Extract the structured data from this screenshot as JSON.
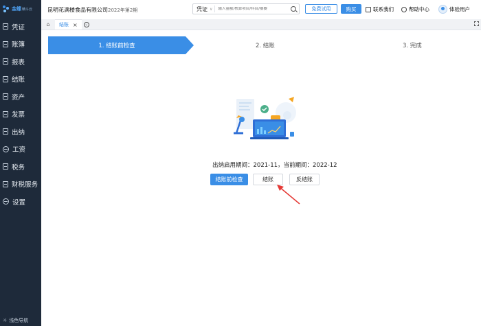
{
  "app": {
    "logo_text": "金蝶",
    "logo_sub": "精斗云"
  },
  "sidebar": {
    "items": [
      {
        "label": "凭证",
        "icon": "voucher-icon"
      },
      {
        "label": "账簿",
        "icon": "ledger-icon"
      },
      {
        "label": "报表",
        "icon": "report-icon"
      },
      {
        "label": "结账",
        "icon": "closing-icon"
      },
      {
        "label": "资产",
        "icon": "asset-icon"
      },
      {
        "label": "发票",
        "icon": "invoice-icon"
      },
      {
        "label": "出纳",
        "icon": "cashier-icon"
      },
      {
        "label": "工资",
        "icon": "salary-icon"
      },
      {
        "label": "税务",
        "icon": "tax-icon"
      },
      {
        "label": "财税服务",
        "icon": "finance-service-icon"
      },
      {
        "label": "设置",
        "icon": "settings-icon"
      }
    ],
    "footer_label": "浅色导航"
  },
  "header": {
    "company": "昆明花满楼食品有限公司",
    "period": "2022年第2期",
    "search_select": "凭证",
    "search_placeholder": "输入金额/核算项目/科目/摘要",
    "trial_label": "免费试用",
    "buy_label": "购买",
    "contact_label": "联系我们",
    "help_label": "帮助中心",
    "user_label": "体验用户"
  },
  "tabs": {
    "items": [
      {
        "label": "结账",
        "active": true
      }
    ],
    "close_glyph": "×"
  },
  "steps": [
    {
      "label": "1. 结账前检查",
      "active": true
    },
    {
      "label": "2. 结账",
      "active": false
    },
    {
      "label": "3. 完成",
      "active": false
    }
  ],
  "main": {
    "status_text": "出纳启用期间：2021-11，当前期间：2022-12",
    "precheck_label": "结账前检查",
    "close_label": "结账",
    "reverse_label": "反结账"
  },
  "colors": {
    "sidebar_bg": "#1e2a3a",
    "accent": "#3a8ee6",
    "arrow": "#e53935"
  }
}
